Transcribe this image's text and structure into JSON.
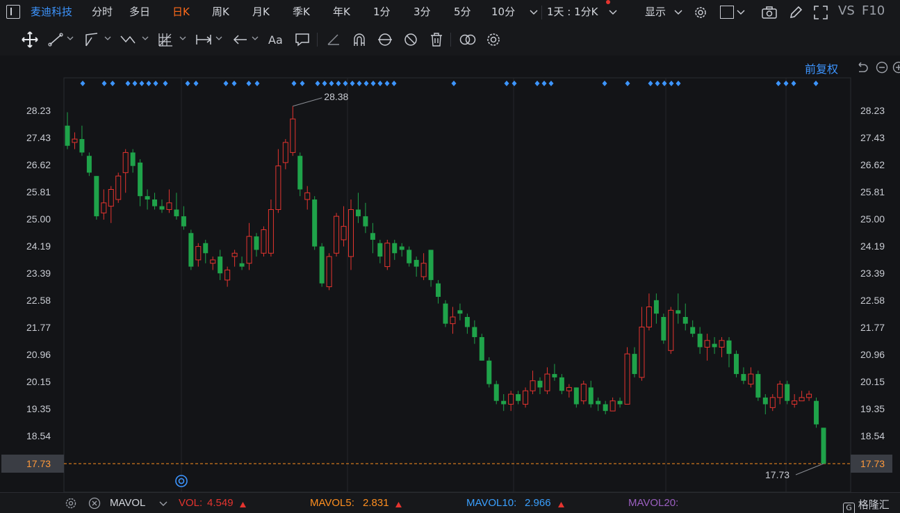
{
  "topbar": {
    "stock_name": "麦迪科技",
    "tabs": [
      "分时",
      "多日",
      "日K",
      "周K",
      "月K",
      "季K",
      "年K",
      "1分",
      "3分",
      "5分",
      "10分"
    ],
    "active_tab": "日K",
    "period_select": "1天 : 1分K",
    "display_label": "显示",
    "vs_label": "VS",
    "f10_label": "F10"
  },
  "adjust_label": "前复权",
  "price_axis": [
    "28.23",
    "27.43",
    "26.62",
    "25.81",
    "25.00",
    "24.19",
    "23.39",
    "22.58",
    "21.77",
    "20.96",
    "20.15",
    "19.35",
    "18.54",
    "17.73"
  ],
  "current_price": "17.73",
  "chart_data": {
    "type": "candlestick",
    "ylim": [
      17.2,
      28.9
    ],
    "high_label": "28.38",
    "low_label": "17.73",
    "up_color": "#e5342f",
    "down_color": "#1fa34a",
    "candles": [
      [
        27.8,
        27.2,
        28.2,
        27.1
      ],
      [
        27.3,
        27.4,
        27.6,
        27.1
      ],
      [
        27.4,
        27.0,
        27.8,
        26.9
      ],
      [
        26.9,
        26.4,
        27.0,
        26.3
      ],
      [
        26.3,
        25.1,
        26.3,
        25.0
      ],
      [
        25.2,
        25.5,
        25.9,
        25.0
      ],
      [
        25.4,
        25.9,
        26.0,
        24.9
      ],
      [
        25.6,
        26.3,
        26.4,
        25.5
      ],
      [
        26.4,
        27.0,
        27.1,
        25.8
      ],
      [
        27.0,
        26.6,
        27.1,
        26.4
      ],
      [
        26.7,
        25.7,
        26.8,
        25.4
      ],
      [
        25.7,
        25.6,
        25.9,
        25.3
      ],
      [
        25.6,
        25.4,
        25.8,
        25.3
      ],
      [
        25.4,
        25.3,
        25.6,
        25.2
      ],
      [
        25.3,
        25.5,
        25.9,
        25.2
      ],
      [
        25.3,
        25.1,
        25.8,
        25.0
      ],
      [
        25.1,
        24.8,
        25.4,
        24.7
      ],
      [
        24.6,
        23.6,
        24.7,
        23.5
      ],
      [
        23.8,
        24.2,
        24.3,
        23.6
      ],
      [
        24.3,
        24.0,
        24.4,
        23.7
      ],
      [
        23.7,
        23.8,
        23.9,
        23.5
      ],
      [
        23.9,
        23.4,
        24.1,
        23.2
      ],
      [
        23.2,
        23.5,
        23.6,
        23.0
      ],
      [
        23.9,
        24.0,
        24.1,
        23.6
      ],
      [
        23.7,
        23.6,
        23.9,
        23.5
      ],
      [
        23.7,
        24.5,
        24.9,
        23.5
      ],
      [
        24.5,
        24.1,
        24.6,
        23.9
      ],
      [
        24.0,
        24.7,
        24.8,
        23.9
      ],
      [
        24.0,
        25.3,
        25.6,
        23.9
      ],
      [
        25.3,
        26.6,
        27.1,
        25.2
      ],
      [
        26.7,
        27.3,
        27.4,
        26.5
      ],
      [
        27.0,
        28.0,
        28.38,
        26.9
      ],
      [
        26.9,
        25.9,
        27.0,
        25.7
      ],
      [
        25.6,
        25.8,
        26.0,
        25.3
      ],
      [
        25.6,
        24.2,
        25.7,
        24.1
      ],
      [
        24.2,
        23.1,
        24.3,
        23.0
      ],
      [
        23.0,
        23.9,
        24.0,
        22.9
      ],
      [
        24.0,
        25.1,
        25.2,
        23.9
      ],
      [
        24.4,
        24.8,
        25.4,
        24.2
      ],
      [
        23.9,
        25.3,
        25.6,
        23.5
      ],
      [
        25.3,
        25.1,
        25.8,
        24.9
      ],
      [
        25.1,
        24.8,
        25.5,
        24.6
      ],
      [
        24.6,
        24.4,
        24.9,
        24.0
      ],
      [
        24.3,
        23.9,
        24.4,
        23.7
      ],
      [
        23.6,
        24.3,
        24.4,
        23.5
      ],
      [
        24.3,
        24.0,
        24.4,
        23.8
      ],
      [
        24.2,
        24.1,
        24.3,
        23.9
      ],
      [
        24.1,
        23.7,
        24.2,
        23.6
      ],
      [
        23.8,
        23.6,
        23.9,
        23.3
      ],
      [
        23.3,
        23.7,
        24.0,
        23.2
      ],
      [
        24.1,
        23.2,
        24.1,
        23.0
      ],
      [
        23.1,
        22.7,
        23.2,
        22.5
      ],
      [
        22.5,
        21.9,
        22.6,
        21.8
      ],
      [
        21.9,
        22.1,
        22.4,
        21.6
      ],
      [
        22.3,
        22.2,
        22.5,
        22.0
      ],
      [
        22.1,
        21.8,
        22.2,
        21.6
      ],
      [
        21.8,
        21.5,
        22.0,
        21.3
      ],
      [
        21.5,
        20.8,
        21.6,
        20.8
      ],
      [
        20.8,
        20.1,
        20.9,
        20.0
      ],
      [
        20.1,
        19.6,
        20.2,
        19.5
      ],
      [
        19.6,
        19.5,
        19.8,
        19.3
      ],
      [
        19.5,
        19.8,
        19.9,
        19.3
      ],
      [
        19.8,
        19.6,
        19.9,
        19.5
      ],
      [
        19.5,
        19.9,
        20.0,
        19.4
      ],
      [
        19.9,
        20.2,
        20.5,
        19.8
      ],
      [
        20.2,
        20.0,
        20.3,
        19.8
      ],
      [
        19.9,
        20.4,
        20.6,
        19.8
      ],
      [
        20.4,
        20.3,
        20.7,
        20.2
      ],
      [
        20.3,
        19.9,
        20.4,
        19.8
      ],
      [
        19.9,
        20.0,
        20.1,
        19.7
      ],
      [
        20.0,
        19.5,
        20.0,
        19.4
      ],
      [
        19.6,
        20.1,
        20.2,
        19.5
      ],
      [
        20.0,
        19.5,
        20.2,
        19.4
      ],
      [
        19.6,
        19.5,
        19.7,
        19.3
      ],
      [
        19.5,
        19.3,
        19.6,
        19.2
      ],
      [
        19.3,
        19.6,
        19.7,
        19.3
      ],
      [
        19.6,
        19.5,
        19.7,
        19.4
      ],
      [
        19.5,
        21.0,
        21.2,
        19.6
      ],
      [
        21.0,
        20.4,
        21.2,
        20.3
      ],
      [
        20.3,
        21.8,
        22.4,
        20.2
      ],
      [
        21.8,
        22.4,
        22.8,
        21.7
      ],
      [
        22.6,
        22.2,
        22.8,
        21.9
      ],
      [
        22.1,
        21.4,
        22.2,
        21.3
      ],
      [
        21.1,
        22.3,
        22.4,
        21.0
      ],
      [
        22.3,
        22.2,
        22.8,
        21.9
      ],
      [
        22.1,
        21.9,
        22.5,
        21.7
      ],
      [
        21.8,
        21.6,
        22.0,
        21.5
      ],
      [
        21.6,
        21.2,
        21.8,
        21.0
      ],
      [
        21.2,
        21.4,
        21.6,
        20.8
      ],
      [
        21.3,
        21.2,
        21.5,
        21.0
      ],
      [
        21.2,
        21.4,
        21.5,
        20.9
      ],
      [
        21.4,
        21.0,
        21.5,
        20.6
      ],
      [
        21.0,
        20.4,
        21.1,
        20.3
      ],
      [
        20.4,
        20.2,
        20.6,
        20.1
      ],
      [
        20.1,
        20.4,
        20.6,
        20.0
      ],
      [
        20.4,
        19.7,
        20.5,
        19.6
      ],
      [
        19.7,
        19.5,
        19.8,
        19.2
      ],
      [
        19.4,
        19.7,
        19.8,
        19.3
      ],
      [
        19.7,
        20.1,
        20.2,
        19.5
      ],
      [
        20.1,
        19.6,
        20.2,
        19.5
      ],
      [
        19.5,
        19.6,
        19.8,
        19.4
      ],
      [
        19.6,
        19.7,
        19.9,
        19.6
      ],
      [
        19.7,
        19.8,
        19.9,
        19.6
      ],
      [
        19.6,
        18.9,
        19.7,
        18.8
      ],
      [
        18.8,
        17.73,
        18.8,
        17.73
      ]
    ]
  },
  "volume_bar": {
    "indicator": "MAVOL",
    "vol_label": "VOL:",
    "vol_value": "4.549",
    "ma5_label": "MAVOL5:",
    "ma5_value": "2.831",
    "ma10_label": "MAVOL10:",
    "ma10_value": "2.966",
    "ma20_label": "MAVOL20:",
    "colors": {
      "vol": "#e5342f",
      "ma5": "#ff8f1f",
      "ma10": "#3aa0ff",
      "ma20": "#9b5fc0"
    }
  },
  "brand": "格隆汇"
}
